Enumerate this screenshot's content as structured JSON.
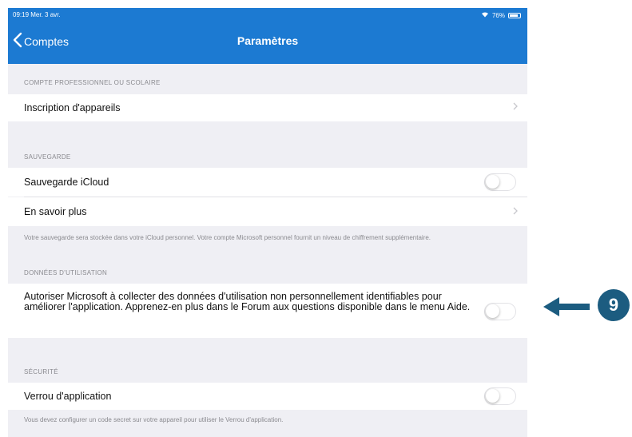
{
  "status_bar": {
    "time": "09:19  Mer. 3 avr.",
    "battery": "76%",
    "wifi_icon": "wifi-icon",
    "battery_icon": "battery-icon"
  },
  "nav": {
    "back_label": "Comptes",
    "title": "Paramètres"
  },
  "sections": {
    "work": {
      "header": "COMPTE PROFESSIONNEL OU SCOLAIRE",
      "device_enrollment": "Inscription d'appareils"
    },
    "backup": {
      "header": "SAUVEGARDE",
      "icloud_backup": "Sauvegarde iCloud",
      "icloud_backup_on": false,
      "learn_more": "En savoir plus",
      "footer": "Votre sauvegarde sera stockée dans votre iCloud personnel. Votre compte Microsoft personnel fournit un niveau de chiffrement supplémentaire."
    },
    "usage": {
      "header": "DONNÉES D'UTILISATION",
      "allow_collection": "Autoriser Microsoft à collecter des données d'utilisation non personnellement identifiables pour améliorer l'application. Apprenez-en plus dans le Forum aux questions disponible dans le menu Aide.",
      "allow_collection_on": false
    },
    "security": {
      "header": "SÉCURITÉ",
      "app_lock": "Verrou d'application",
      "app_lock_on": false,
      "footer": "Vous devez configurer un code secret sur votre appareil pour utiliser le Verrou d'application."
    }
  },
  "callout": {
    "number": "9",
    "color": "#1c5c80"
  },
  "colors": {
    "accent": "#1c7ad2",
    "background": "#efeff4"
  }
}
